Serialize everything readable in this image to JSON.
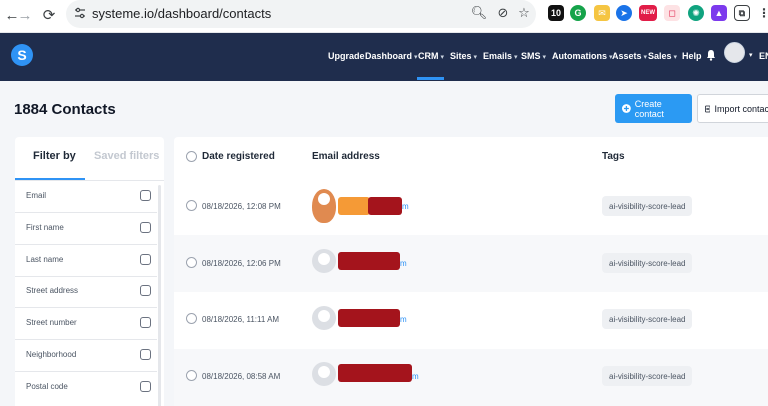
{
  "browser": {
    "url": "systeme.io/dashboard/contacts",
    "ext_badges": [
      "10",
      "NEW"
    ]
  },
  "app": {
    "logo_letter": "S",
    "nav": [
      {
        "label": "Upgrade",
        "caret": false
      },
      {
        "label": "Dashboard",
        "caret": true
      },
      {
        "label": "CRM",
        "caret": true
      },
      {
        "label": "Sites",
        "caret": true
      },
      {
        "label": "Emails",
        "caret": true
      },
      {
        "label": "SMS",
        "caret": true
      },
      {
        "label": "Automations",
        "caret": true
      },
      {
        "label": "Assets",
        "caret": true
      },
      {
        "label": "Sales",
        "caret": true
      },
      {
        "label": "Help",
        "caret": false
      }
    ],
    "active_nav": "CRM",
    "lang": "EN"
  },
  "page": {
    "title": "1884 Contacts",
    "create_button": "Create contact",
    "import_button": "Import contacts"
  },
  "filters": {
    "tabs": [
      "Filter by",
      "Saved filters"
    ],
    "items": [
      "Email",
      "First name",
      "Last name",
      "Street address",
      "Street number",
      "Neighborhood",
      "Postal code"
    ]
  },
  "table": {
    "headers": [
      "Date registered",
      "Email address",
      "Tags"
    ],
    "rows": [
      {
        "date": "08/18/2026, 12:08 PM",
        "email_tail": "m",
        "tag": "ai-visibility-score-lead"
      },
      {
        "date": "08/18/2026, 12:06 PM",
        "email_tail": "m",
        "tag": "ai-visibility-score-lead"
      },
      {
        "date": "08/18/2026, 11:11 AM",
        "email_tail": "m",
        "tag": "ai-visibility-score-lead"
      },
      {
        "date": "08/18/2026, 08:58 AM",
        "email_tail": "m",
        "tag": "ai-visibility-score-lead"
      }
    ]
  },
  "colors": {
    "navbar": "#1f2d4d",
    "accent": "#2b9af3",
    "redaction": "#a4141c"
  }
}
